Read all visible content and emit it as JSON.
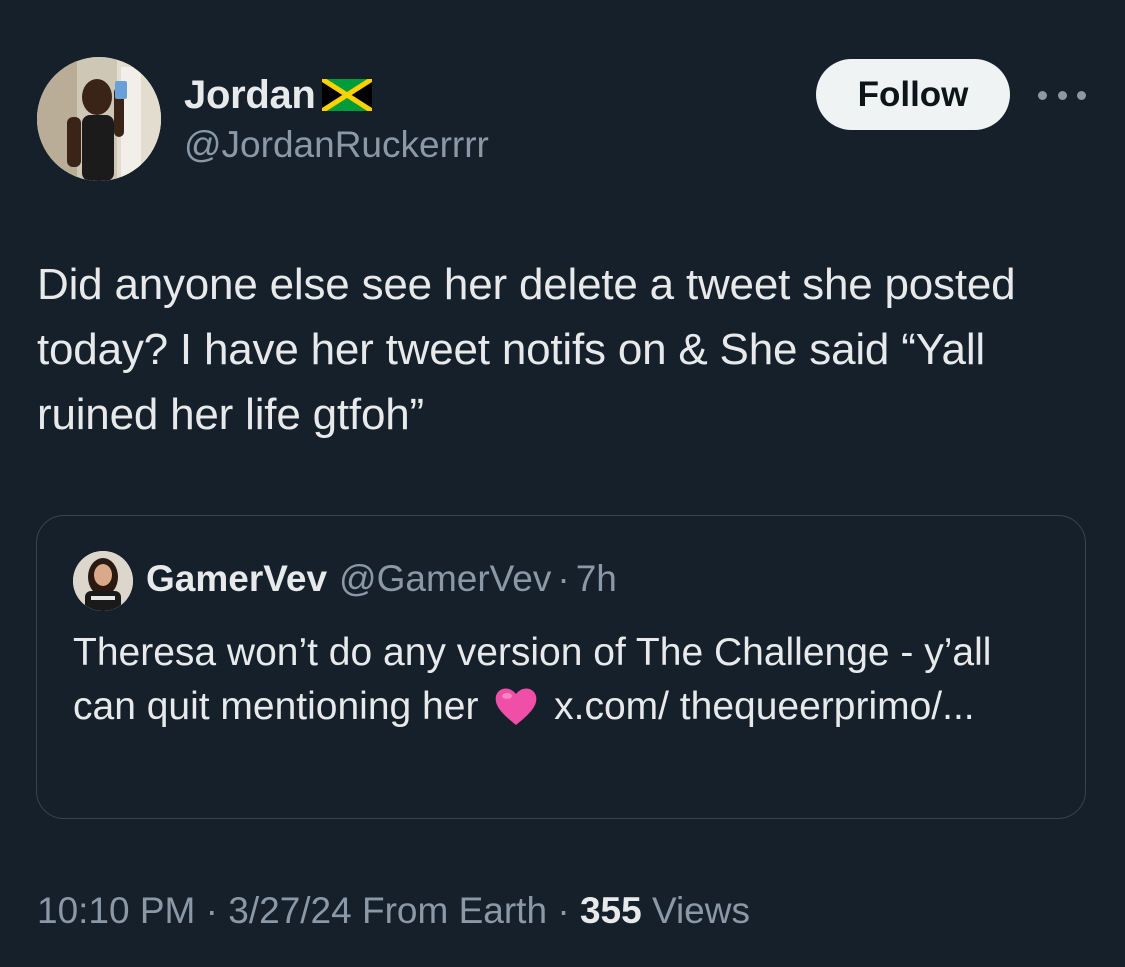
{
  "author": {
    "display_name": "Jordan",
    "flag_icon": "jamaica-flag-icon",
    "handle": "@JordanRuckerrrr"
  },
  "follow_button_label": "Follow",
  "more_icon": "more-horizontal-icon",
  "tweet_text": "Did anyone else see her delete a tweet she posted today? I have her tweet notifs on & She said “Yall ruined her life gtfoh”",
  "quoted_tweet": {
    "display_name": "GamerVev",
    "handle": "@GamerVev",
    "separator": "·",
    "time": "7h",
    "text_before_emoji": "Theresa won’t do any version of The Challenge - y’all can quit mentioning her",
    "emoji_icon": "pink-heart-icon",
    "text_after_emoji": "x.com/ thequeerprimo/..."
  },
  "meta": {
    "time": "10:10 PM",
    "separator": "·",
    "date": "3/27/24",
    "source": "From Earth",
    "views_count": "355",
    "views_label": "Views"
  },
  "colors": {
    "background": "#15202b",
    "primary_text": "#e7e9ea",
    "secondary_text": "#8b98a5",
    "follow_button_bg": "#eff3f4",
    "card_border": "#38444d",
    "heart": "#f04fa8"
  }
}
